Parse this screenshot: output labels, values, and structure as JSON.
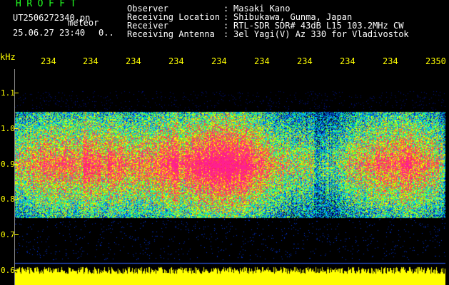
{
  "header": {
    "app_title": "HROFFT",
    "file_name": "UT2506272340.pn",
    "file_tag": "meteor",
    "date_time": "25.06.27 23:40",
    "progress": "0.."
  },
  "info": [
    {
      "label": "Observer",
      "value": "Masaki Kano"
    },
    {
      "label": "Receiving Location",
      "value": "Shibukawa, Gunma, Japan"
    },
    {
      "label": "Receiver",
      "value": "RTL-SDR SDR# 43dB L15 103.2MHz CW"
    },
    {
      "label": "Receiving Antenna",
      "value": "3el Yagi(V) Az 330 for Vladivostok"
    }
  ],
  "axis": {
    "unit": "kHz",
    "time_ticks": [
      "234",
      "234",
      "234",
      "234",
      "234",
      "234",
      "234",
      "234",
      "234",
      "2350"
    ],
    "freq_ticks": [
      "1.1",
      "1.0",
      "0.9",
      "0.8",
      "0.7",
      "0.6"
    ]
  },
  "colors": {
    "background": "#000000",
    "axis_text": "#ffff00",
    "title": "#22ff22",
    "text": "#ffffff"
  }
}
